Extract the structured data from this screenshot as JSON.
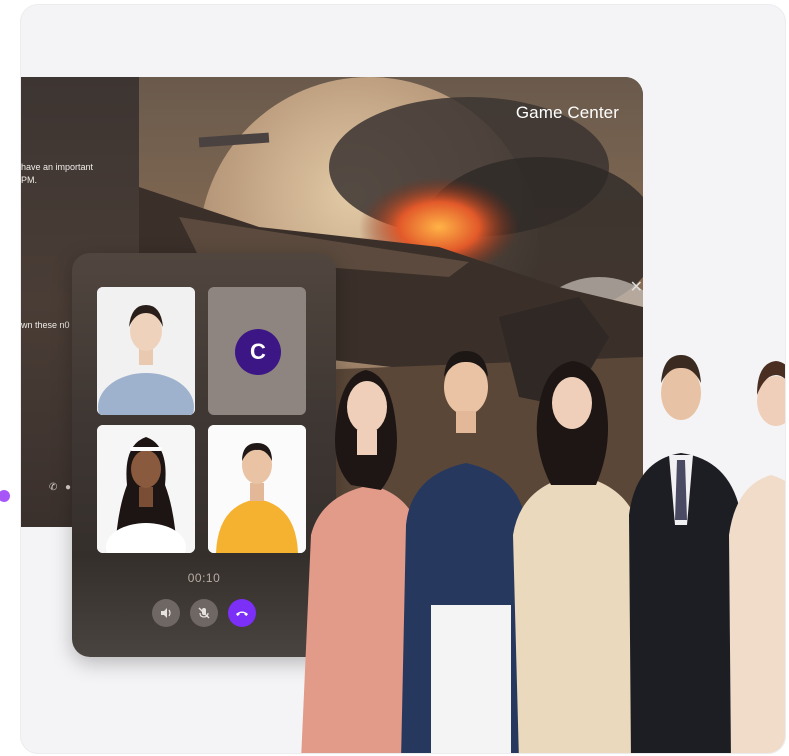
{
  "game": {
    "title": "Game Center",
    "chat_lines": [
      "have an important",
      "PM.",
      "wn these n0"
    ]
  },
  "call": {
    "avatar_letter": "C",
    "timer": "00:10"
  },
  "icons": {
    "speaker": "speaker-icon",
    "mute": "mic-off-icon",
    "end": "phone-end-icon",
    "close": "close-icon",
    "chat_phone": "phone-icon",
    "chat_mic": "mic-icon"
  },
  "colors": {
    "accent": "#7b2ff7",
    "avatar_bg": "#3d1686",
    "indicator": "#a855f7"
  }
}
